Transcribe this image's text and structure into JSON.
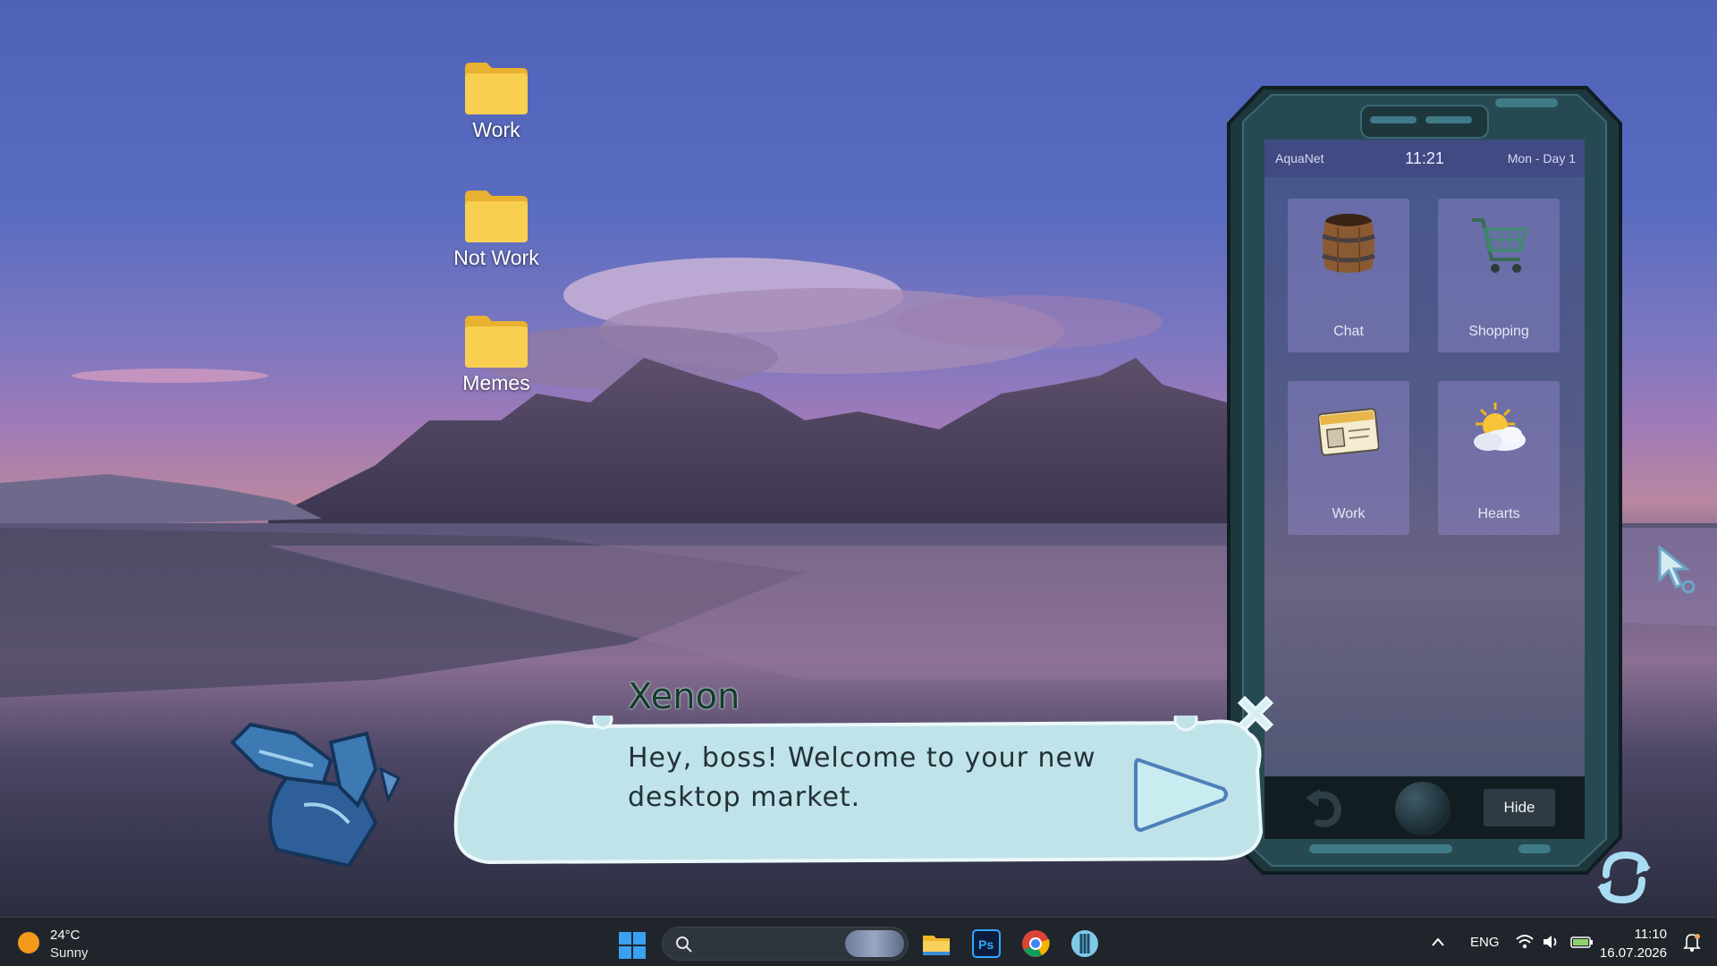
{
  "desktop": {
    "icons": [
      {
        "label": "Work"
      },
      {
        "label": "Not Work"
      },
      {
        "label": "Memes"
      }
    ]
  },
  "phone": {
    "carrier": "AquaNet",
    "time": "11:21",
    "day": "Mon - Day 1",
    "apps": [
      {
        "label": "Chat",
        "icon": "barrel-icon"
      },
      {
        "label": "Shopping",
        "icon": "shopping-cart-icon"
      },
      {
        "label": "Work",
        "icon": "id-card-icon"
      },
      {
        "label": "Hearts",
        "icon": "sun-cloud-icon"
      }
    ],
    "hide_label": "Hide"
  },
  "dialog": {
    "speaker": "Xenon",
    "text_line1": "Hey, boss! Welcome to your new",
    "text_line2": "desktop market."
  },
  "taskbar": {
    "weather_temp": "24°C",
    "weather_desc": "Sunny",
    "language": "ENG",
    "time": "11:10",
    "date": "16.07.2026"
  },
  "colors": {
    "dialog_fill": "#bfe3e8",
    "phone_frame": "#1f3a40",
    "taskbar": "#20252b",
    "folder": "#f7c948"
  }
}
